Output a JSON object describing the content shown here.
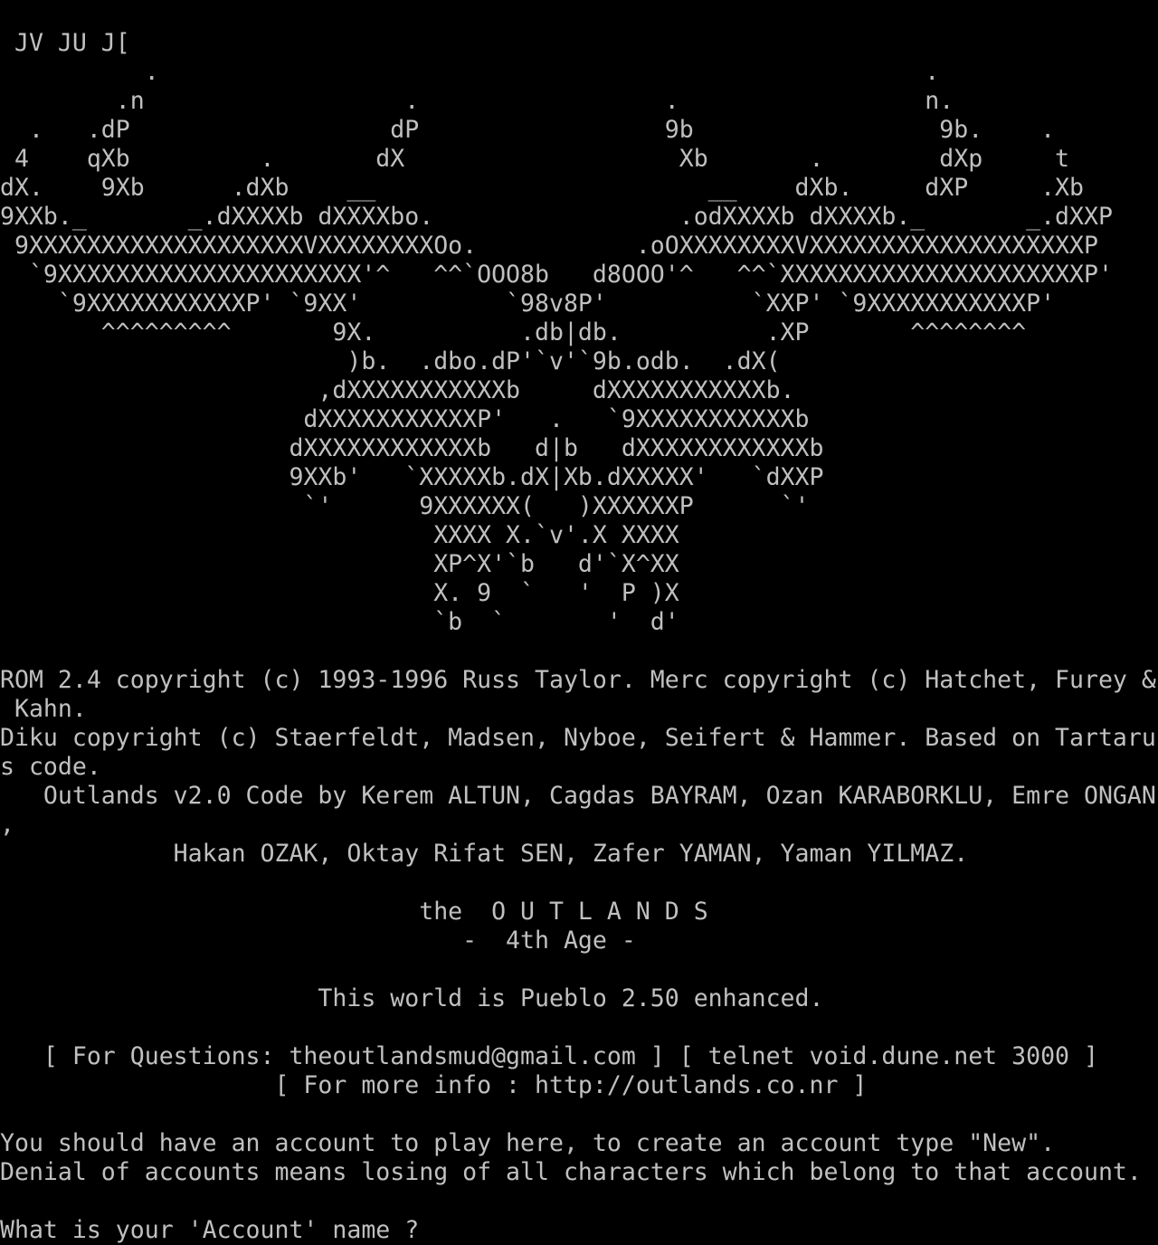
{
  "terminal": {
    "lines": [
      " JV JU J[",
      "          .                                                     .",
      "        .n                  .                 .                 n.",
      "  .   .dP                  dP                 9b                 9b.    .",
      " 4    qXb         .       dX                   Xb       .        dXp     t",
      "dX.    9Xb      .dXb    __                       __    dXb.     dXP     .Xb",
      "9XXb._       _.dXXXXb dXXXXbo.                 .odXXXXb dXXXXb._       _.dXXP",
      " 9XXXXXXXXXXXXXXXXXXXVXXXXXXXXOo.           .oOXXXXXXXXVXXXXXXXXXXXXXXXXXXXP",
      "  `9XXXXXXXXXXXXXXXXXXXXX'^   ^^`OOO8b   d8OOO'^   ^^`XXXXXXXXXXXXXXXXXXXXXP'",
      "    `9XXXXXXXXXXXP' `9XX'          `98v8P'          `XXP' `9XXXXXXXXXXXP'",
      "       ^^^^^^^^^       9X.          .db|db.          .XP       ^^^^^^^^",
      "                        )b.  .dbo.dP'`v'`9b.odb.  .dX(",
      "                      ,dXXXXXXXXXXXb     dXXXXXXXXXXXb.",
      "                     dXXXXXXXXXXXP'   .   `9XXXXXXXXXXXb",
      "                    dXXXXXXXXXXXXb   d|b   dXXXXXXXXXXXXb",
      "                    9XXb'   `XXXXXb.dX|Xb.dXXXXX'   `dXXP",
      "                     `'      9XXXXXX(   )XXXXXXP      `'",
      "                              XXXX X.`v'.X XXXX",
      "                              XP^X'`b   d'`X^XX",
      "                              X. 9  `   '  P )X",
      "                              `b  `       '  d'",
      "",
      "ROM 2.4 copyright (c) 1993-1996 Russ Taylor. Merc copyright (c) Hatchet, Furey &",
      " Kahn.",
      "Diku copyright (c) Staerfeldt, Madsen, Nyboe, Seifert & Hammer. Based on Tartaru",
      "s code.",
      "   Outlands v2.0 Code by Kerem ALTUN, Cagdas BAYRAM, Ozan KARABORKLU, Emre ONGAN",
      ",",
      "            Hakan OZAK, Oktay Rifat SEN, Zafer YAMAN, Yaman YILMAZ.",
      "",
      "                             the  O U T L A N D S",
      "                                -  4th Age -",
      "",
      "                      This world is Pueblo 2.50 enhanced.",
      "",
      "   [ For Questions: theoutlandsmud@gmail.com ] [ telnet void.dune.net 3000 ]",
      "                   [ For more info : http://outlands.co.nr ]",
      "",
      "You should have an account to play here, to create an account type \"New\".",
      "Denial of accounts means losing of all characters which belong to that account.",
      "",
      "What is your 'Account' name ?"
    ]
  }
}
